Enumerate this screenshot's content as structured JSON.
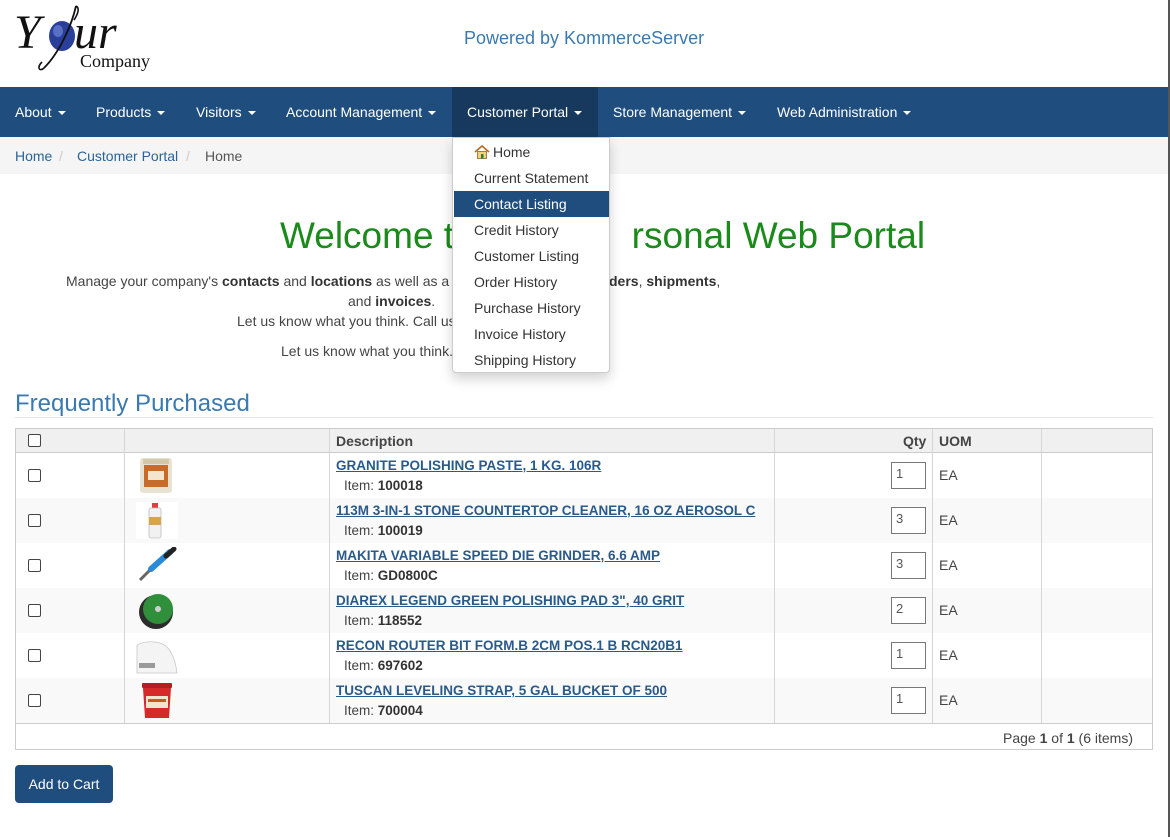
{
  "header": {
    "logo_your": "Your",
    "logo_company": "Company",
    "powered_by": "Powered by KommerceServer"
  },
  "nav": {
    "items": [
      {
        "label": "About"
      },
      {
        "label": "Products"
      },
      {
        "label": "Visitors"
      },
      {
        "label": "Account Management"
      },
      {
        "label": "Customer Portal",
        "active": true
      },
      {
        "label": "Store Management"
      },
      {
        "label": "Web Administration"
      }
    ]
  },
  "breadcrumb": {
    "items": [
      "Home",
      "Customer Portal",
      "Home"
    ],
    "separator": "/"
  },
  "dropdown": {
    "items": [
      {
        "label": "Home",
        "icon": "home-icon"
      },
      {
        "label": "Current Statement"
      },
      {
        "label": "Contact Listing",
        "active": true
      },
      {
        "label": "Credit History"
      },
      {
        "label": "Customer Listing"
      },
      {
        "label": "Order History"
      },
      {
        "label": "Purchase History"
      },
      {
        "label": "Invoice History"
      },
      {
        "label": "Shipping History"
      }
    ]
  },
  "welcome": {
    "title_left": "Welcome to",
    "title_right": "rsonal Web Portal",
    "l1_a": "Manage your company's ",
    "l1_contacts": "contacts",
    "l1_b": " and ",
    "l1_locations": "locations",
    "l1_c": " as well as a",
    "l1_orders": "ders",
    "l1_d": ", ",
    "l1_shipments": "shipments",
    "l1_e": ",",
    "l2_a": "and ",
    "l2_invoices": "invoices",
    "l2_b": ".",
    "l3": "Let us know what you think. Call us",
    "l4": "Let us know what you think."
  },
  "frequently_purchased": {
    "title": "Frequently Purchased",
    "headers": {
      "description": "Description",
      "qty": "Qty",
      "uom": "UOM"
    },
    "item_prefix": "Item: ",
    "rows": [
      {
        "description": "GRANITE POLISHING PASTE, 1 KG. 106R",
        "item": "100018",
        "qty": "1",
        "uom": "EA",
        "thumb": "paste-jar"
      },
      {
        "description": "113M 3-IN-1 STONE COUNTERTOP CLEANER, 16 OZ AEROSOL C",
        "item": "100019",
        "qty": "3",
        "uom": "EA",
        "thumb": "aerosol-can"
      },
      {
        "description": "MAKITA VARIABLE SPEED DIE GRINDER, 6.6 AMP",
        "item": "GD0800C",
        "qty": "3",
        "uom": "EA",
        "thumb": "die-grinder"
      },
      {
        "description": "DIAREX LEGEND GREEN POLISHING PAD 3\", 40 GRIT",
        "item": "118552",
        "qty": "2",
        "uom": "EA",
        "thumb": "polishing-pad"
      },
      {
        "description": "RECON ROUTER BIT FORM.B 2CM POS.1 B RCN20B1",
        "item": "697602",
        "qty": "1",
        "uom": "EA",
        "thumb": "router-bit-profile"
      },
      {
        "description": "TUSCAN LEVELING STRAP, 5 GAL BUCKET OF 500",
        "item": "700004",
        "qty": "1",
        "uom": "EA",
        "thumb": "bucket"
      }
    ],
    "pager": {
      "a": "Page ",
      "page": "1",
      "b": " of ",
      "pages": "1",
      "c": " (6 items)"
    }
  },
  "actions": {
    "add_to_cart": "Add to Cart"
  },
  "colors": {
    "navbar": "#1f4d7e",
    "navbar_active": "#17395d",
    "welcome_title": "#1a8a1a",
    "link": "#2a6496",
    "section_title": "#3a7ab0"
  }
}
